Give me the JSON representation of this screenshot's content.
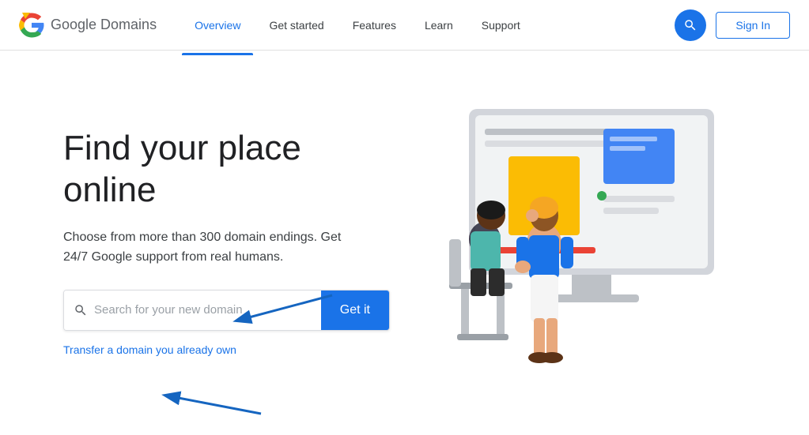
{
  "brand": {
    "logo_text": "Google Domains",
    "logo_alt": "Google Domains logo"
  },
  "nav": {
    "items": [
      {
        "id": "overview",
        "label": "Overview",
        "active": true
      },
      {
        "id": "get-started",
        "label": "Get started",
        "active": false
      },
      {
        "id": "features",
        "label": "Features",
        "active": false
      },
      {
        "id": "learn",
        "label": "Learn",
        "active": false
      },
      {
        "id": "support",
        "label": "Support",
        "active": false
      }
    ]
  },
  "header": {
    "search_label": "Search",
    "signin_label": "Sign In"
  },
  "hero": {
    "headline": "Find your place online",
    "subheadline": "Choose from more than 300 domain endings. Get 24/7 Google support from real humans.",
    "search_placeholder": "Search for your new domain",
    "cta_label": "Get it",
    "transfer_label": "Transfer a domain you already own"
  },
  "colors": {
    "blue": "#1a73e8",
    "text_dark": "#202124",
    "text_medium": "#3c4043",
    "text_light": "#9aa0a6"
  }
}
